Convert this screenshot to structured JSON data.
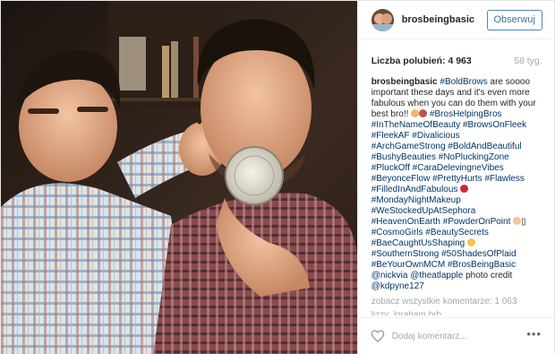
{
  "post": {
    "username": "brosbeingbasic",
    "follow_label": "Obserwuj",
    "likes_label": "Liczba polubień: 4 963",
    "time_ago": "58 tyg.",
    "caption": {
      "author": "brosbeingbasic",
      "lines": [
        [
          {
            "t": " "
          },
          {
            "h": "#BoldBrows"
          },
          {
            "t": " are soooo important these days and it's even more fabulous when you can do them with your best bro!! "
          },
          {
            "e": "face-emoji"
          },
          {
            "e": "couple-emoji"
          },
          {
            "t": " "
          },
          {
            "h": "#BrosHelpingBros"
          }
        ],
        [
          {
            "h": "#InTheNameOfBeauty"
          },
          {
            "t": " "
          },
          {
            "h": "#BrowsOnFleek"
          }
        ],
        [
          {
            "h": "#FleekAF"
          },
          {
            "t": " "
          },
          {
            "h": "#Divalicious"
          }
        ],
        [
          {
            "h": "#ArchGameStrong"
          },
          {
            "t": " "
          },
          {
            "h": "#BoldAndBeautiful"
          }
        ],
        [
          {
            "h": "#BushyBeauties"
          },
          {
            "t": " "
          },
          {
            "h": "#NoPluckingZone"
          }
        ],
        [
          {
            "h": "#PluckOff"
          },
          {
            "t": " "
          },
          {
            "h": "#CaraDelevingneVibes"
          }
        ],
        [
          {
            "h": "#BeyonceFlow"
          },
          {
            "t": " "
          },
          {
            "h": "#PrettyHurts"
          },
          {
            "t": " "
          },
          {
            "h": "#Flawless"
          }
        ],
        [
          {
            "h": "#FilledInAndFabulous"
          },
          {
            "t": " "
          },
          {
            "e": "dancer-emoji"
          }
        ],
        [
          {
            "h": "#MondayNightMakeup"
          }
        ],
        [
          {
            "h": "#WeStockedUpAtSephora"
          }
        ],
        [
          {
            "h": "#HeavenOnEarth"
          },
          {
            "t": " "
          },
          {
            "h": "#PowderOnPoint"
          },
          {
            "t": " "
          },
          {
            "e": "ok-hand-emoji"
          },
          {
            "t": "▯"
          }
        ],
        [
          {
            "h": "#CosmoGirls"
          },
          {
            "t": " "
          },
          {
            "h": "#BeautySecrets"
          }
        ],
        [
          {
            "h": "#BaeCaughtUsShaping"
          },
          {
            "t": " "
          },
          {
            "e": "smile-emoji"
          }
        ],
        [
          {
            "h": "#SouthernStrong"
          },
          {
            "t": " "
          },
          {
            "h": "#50ShadesOfPlaid"
          }
        ],
        [
          {
            "h": "#BeYourOwnMCM"
          },
          {
            "t": " "
          },
          {
            "h": "#BrosBeingBasic"
          }
        ],
        [
          {
            "h": "@nickvia"
          },
          {
            "t": " "
          },
          {
            "h": "@theatlapple"
          },
          {
            "t": " photo credit"
          }
        ],
        [
          {
            "h": "@kdpyne127"
          }
        ]
      ]
    },
    "view_all_label": "zobacz wszystkie komentarze: 1 063",
    "cut_comment": "lizzy_lgraham brb",
    "comment_placeholder": "Dodaj komentarz...",
    "more_label": "•••"
  },
  "colors": {
    "hashtag": "#003569",
    "follow_border": "#4e86c0",
    "follow_text": "#3f729b",
    "muted": "#a5a7aa"
  },
  "icons": {
    "like": "heart-icon",
    "more": "more-options-icon",
    "avatar": "profile-avatar"
  }
}
